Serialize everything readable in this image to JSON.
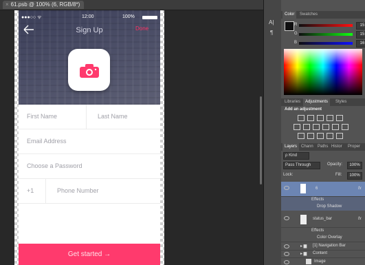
{
  "document": {
    "tab_title": "61.psb @ 100% (6, RGB/8*)",
    "close_glyph": "×"
  },
  "phone": {
    "status": {
      "carrier": "●●●○○ ᯤ",
      "time": "12:00",
      "battery_pct": "100%"
    },
    "title": "Sign Up",
    "done_label": "Done",
    "fields": {
      "first_name": "First Name",
      "last_name": "Last Name",
      "email": "Email Address",
      "password": "Choose a Password",
      "country_code": "+1",
      "phone": "Phone Number"
    },
    "cta_label": "Get started →",
    "colors": {
      "accent": "#ff3a6d",
      "hero": "#3b3e58"
    }
  },
  "toolbar": {
    "items": [
      "A|",
      "¶"
    ]
  },
  "color_panel": {
    "tabs": [
      "Color",
      "Swatches"
    ],
    "channels": [
      {
        "label": "R",
        "value": "15"
      },
      {
        "label": "G",
        "value": "15"
      },
      {
        "label": "B",
        "value": "16"
      }
    ]
  },
  "adjustments_panel": {
    "tabs": [
      "Libraries",
      "Adjustments",
      "Styles"
    ],
    "heading": "Add an adjustment"
  },
  "layers_panel": {
    "tabs": [
      "Layers",
      "Chann",
      "Paths",
      "Histor",
      "Proper"
    ],
    "kind_label": "ρ Kind",
    "blend_mode": "Pass Through",
    "opacity_label": "Opacity:",
    "opacity_value": "100%",
    "lock_label": "Lock:",
    "fill_label": "Fill:",
    "fill_value": "100%",
    "layers": [
      {
        "name": "6",
        "fx": "fx"
      },
      {
        "name": "Effects"
      },
      {
        "name": "Drop Shadow"
      },
      {
        "name": "status_bar",
        "fx": "fx"
      },
      {
        "name": "Effects"
      },
      {
        "name": "Color Overlay"
      },
      {
        "name": "[1] Navigation Bar"
      },
      {
        "name": "Content"
      },
      {
        "name": "Image"
      }
    ]
  }
}
